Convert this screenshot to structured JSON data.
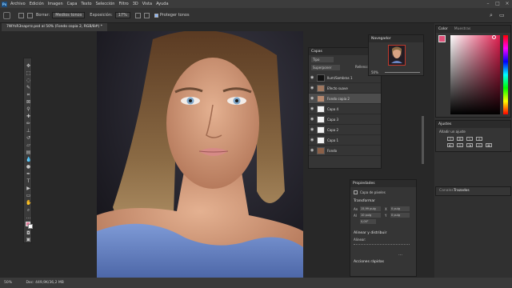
{
  "app": {
    "logo": "Ps"
  },
  "menubar": {
    "items": [
      "Archivo",
      "Edición",
      "Imagen",
      "Capa",
      "Texto",
      "Selección",
      "Filtro",
      "3D",
      "Vista",
      "Ayuda"
    ]
  },
  "options": {
    "brush_label": "Borrar:",
    "brush_value": "Medios tonos",
    "exposure_label": "Exposición:",
    "exposure_value": "17%",
    "protect_label": "Proteger tonos"
  },
  "document": {
    "tab_title": "7WYsR3naprrz.psd al 50% (Fondo copia 2, RGB/8#) *"
  },
  "status": {
    "zoom": "50%",
    "doc": "Doc: 449,9K/36,2 MB"
  },
  "colors": {
    "foreground": "#e07a9a",
    "accent": "#e0527a"
  },
  "layers_panel": {
    "title": "Capas",
    "kind_label": "Tipo",
    "blend_mode": "Superponer",
    "opacity_label": "Relleno:",
    "layers": [
      {
        "name": "Ilum/Sombras 1"
      },
      {
        "name": "Efecto suave"
      },
      {
        "name": "Fondo copia 2"
      },
      {
        "name": "Capa 4"
      },
      {
        "name": "Capa 3"
      },
      {
        "name": "Capa 2"
      },
      {
        "name": "Capa 1"
      },
      {
        "name": "Fondo"
      }
    ]
  },
  "navigator_panel": {
    "title": "Navegador",
    "zoom": "50%"
  },
  "color_panel": {
    "tabs": [
      "Color",
      "Muestras"
    ]
  },
  "adjustments_panel": {
    "title": "Ajustes",
    "subtitle": "Añadir un ajuste"
  },
  "properties_panel": {
    "title": "Propiedades",
    "layer_type": "Capa de píxeles",
    "transform_title": "Transformar",
    "w_label": "An",
    "w_value": "15,99 pulg",
    "h_label": "Al",
    "h_value": "10 pulg",
    "x_label": "X",
    "x_value": "0 pulg",
    "y_label": "Y",
    "y_value": "0 pulg",
    "angle_value": "0,00°",
    "align_title": "Alinear y distribuir",
    "align_label": "Alinear:",
    "quick_title": "Acciones rápidas"
  },
  "bottom_tabs": {
    "tabs": [
      "Canales",
      "Trazados"
    ]
  }
}
